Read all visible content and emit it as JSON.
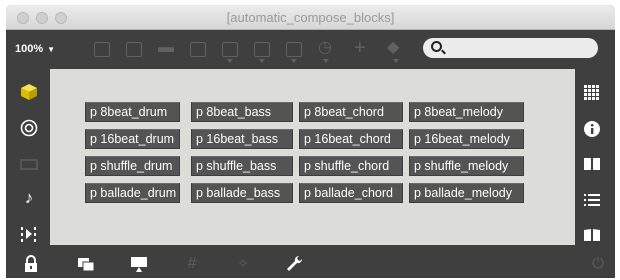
{
  "window": {
    "title": "[automatic_compose_blocks]"
  },
  "toolbar": {
    "zoom": "100%",
    "search_placeholder": ""
  },
  "patch": {
    "rows": [
      [
        "p 8beat_drum",
        "p 8beat_bass",
        "p 8beat_chord",
        "p 8beat_melody"
      ],
      [
        "p 16beat_drum",
        "p 16beat_bass",
        "p 16beat_chord",
        "p 16beat_melody"
      ],
      [
        "p shuffle_drum",
        "p shuffle_bass",
        "p shuffle_chord",
        "p shuffle_melody"
      ],
      [
        "p ballade_drum",
        "p ballade_bass",
        "p ballade_chord",
        "p ballade_melody"
      ]
    ]
  },
  "colors": {
    "accent": "#f0d200",
    "canvas": "#dcdcd8",
    "object_box": "#545454",
    "chrome": "#3f3f3f"
  }
}
